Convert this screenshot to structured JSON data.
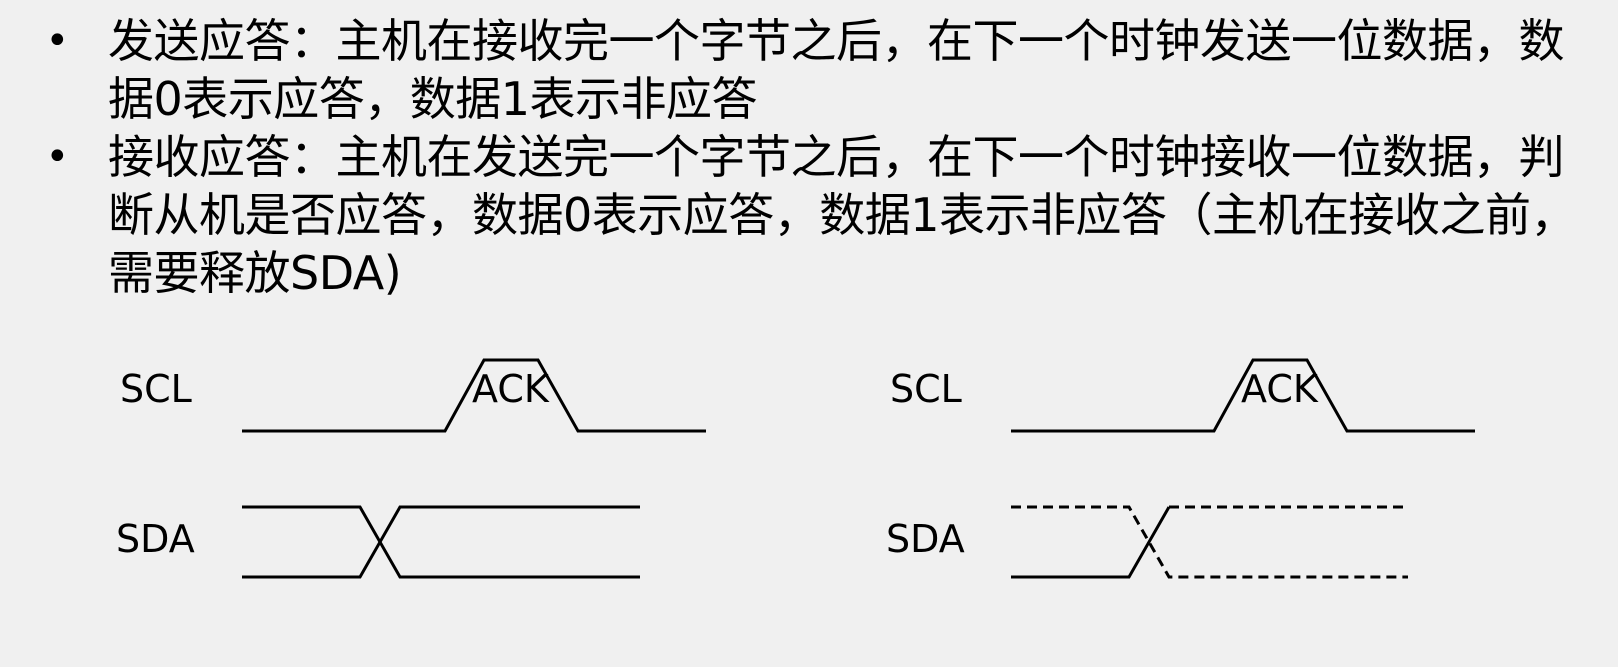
{
  "bullets": [
    {
      "marker": "•",
      "text": "发送应答：主机在接收完一个字节之后，在下一个时钟发送一位数据，数据0表示应答，数据1表示非应答"
    },
    {
      "marker": "•",
      "text": "接收应答：主机在发送完一个字节之后，在下一个时钟接收一位数据，判断从机是否应答，数据0表示应答，数据1表示非应答（主机在接收之前，需要释放SDA)"
    }
  ],
  "diagrams": [
    {
      "scl_label": "SCL",
      "ack_label": "ACK",
      "sda_label": "SDA"
    },
    {
      "scl_label": "SCL",
      "ack_label": "ACK",
      "sda_label": "SDA"
    }
  ]
}
